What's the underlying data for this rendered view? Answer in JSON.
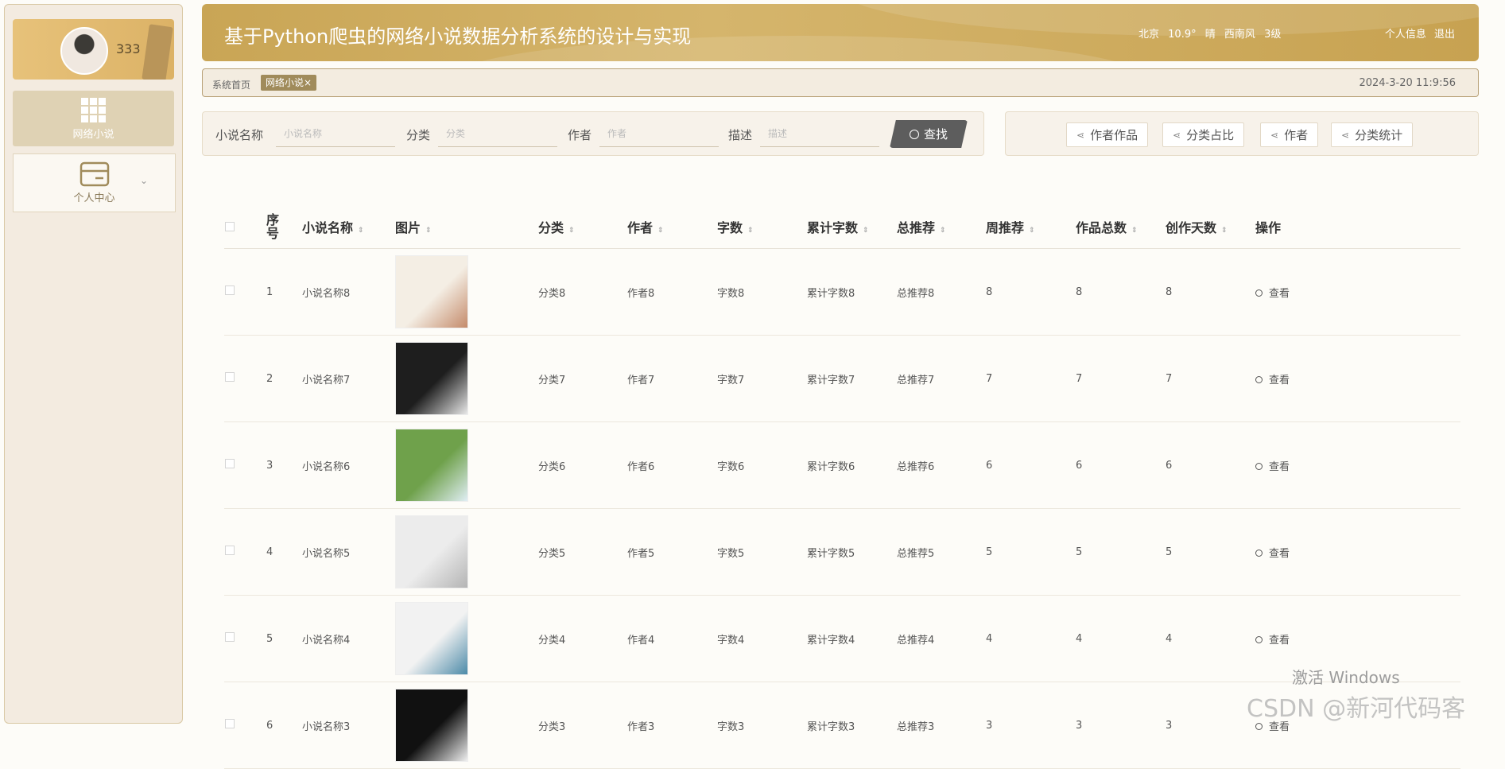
{
  "sidebar": {
    "username": "333",
    "nav": [
      {
        "label": "网络小说",
        "icon": "grid-icon"
      },
      {
        "label": "个人中心",
        "icon": "card-icon"
      }
    ]
  },
  "header": {
    "title": "基于Python爬虫的网络小说数据分析系统的设计与实现",
    "weather": {
      "city": "北京",
      "temp": "10.9°",
      "condition": "晴",
      "wind": "西南风",
      "level": "3级"
    },
    "profile_link": "个人信息",
    "logout_link": "退出"
  },
  "breadcrumb": {
    "home": "系统首页",
    "tag": "网络小说×",
    "datetime": "2024-3-20 11:9:56"
  },
  "search": {
    "name_label": "小说名称",
    "name_placeholder": "小说名称",
    "category_label": "分类",
    "category_placeholder": "分类",
    "author_label": "作者",
    "author_placeholder": "作者",
    "desc_label": "描述",
    "desc_placeholder": "描述",
    "button": "查找"
  },
  "actions": [
    "作者作品",
    "分类占比",
    "作者",
    "分类统计"
  ],
  "table": {
    "headers": [
      "序号",
      "小说名称",
      "图片",
      "分类",
      "作者",
      "字数",
      "累计字数",
      "总推荐",
      "周推荐",
      "作品总数",
      "创作天数",
      "操作"
    ],
    "rows": [
      {
        "idx": "1",
        "name": "小说名称8",
        "category": "分类8",
        "author": "作者8",
        "words": "字数8",
        "total_words": "累计字数8",
        "total_rec": "总推荐8",
        "week_rec": "8",
        "works": "8",
        "days": "8",
        "action": "查看"
      },
      {
        "idx": "2",
        "name": "小说名称7",
        "category": "分类7",
        "author": "作者7",
        "words": "字数7",
        "total_words": "累计字数7",
        "total_rec": "总推荐7",
        "week_rec": "7",
        "works": "7",
        "days": "7",
        "action": "查看"
      },
      {
        "idx": "3",
        "name": "小说名称6",
        "category": "分类6",
        "author": "作者6",
        "words": "字数6",
        "total_words": "累计字数6",
        "total_rec": "总推荐6",
        "week_rec": "6",
        "works": "6",
        "days": "6",
        "action": "查看"
      },
      {
        "idx": "4",
        "name": "小说名称5",
        "category": "分类5",
        "author": "作者5",
        "words": "字数5",
        "total_words": "累计字数5",
        "total_rec": "总推荐5",
        "week_rec": "5",
        "works": "5",
        "days": "5",
        "action": "查看"
      },
      {
        "idx": "5",
        "name": "小说名称4",
        "category": "分类4",
        "author": "作者4",
        "words": "字数4",
        "total_words": "累计字数4",
        "total_rec": "总推荐4",
        "week_rec": "4",
        "works": "4",
        "days": "4",
        "action": "查看"
      },
      {
        "idx": "6",
        "name": "小说名称3",
        "category": "分类3",
        "author": "作者3",
        "words": "字数3",
        "total_words": "累计字数3",
        "total_rec": "总推荐3",
        "week_rec": "3",
        "works": "3",
        "days": "3",
        "action": "查看"
      }
    ]
  },
  "watermarks": {
    "windows": "激活 Windows",
    "csdn": "CSDN @新河代码客"
  }
}
